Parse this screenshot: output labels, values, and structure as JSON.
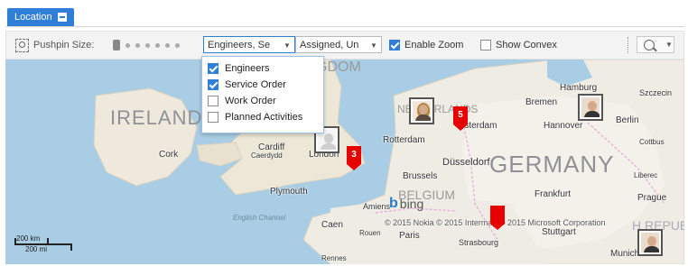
{
  "tab": {
    "label": "Location"
  },
  "toolbar": {
    "pushpin_label": "Pushpin Size:",
    "layer_dropdown": "Engineers, Se",
    "status_dropdown": "Assigned, Un",
    "enable_zoom_label": "Enable Zoom",
    "enable_zoom_checked": true,
    "show_convex_label": "Show Convex",
    "show_convex_checked": false
  },
  "layer_menu": {
    "items": [
      {
        "label": "Engineers",
        "checked": true
      },
      {
        "label": "Service Order",
        "checked": true
      },
      {
        "label": "Work Order",
        "checked": false
      },
      {
        "label": "Planned Activities",
        "checked": false
      }
    ]
  },
  "map": {
    "places": {
      "ireland": "IRELAND",
      "kingdom": "GDOM",
      "germany": "GERMANY",
      "belgium": "BELGIUM",
      "czech": "H REPUBL",
      "cork": "Cork",
      "cardiff": "Cardiff",
      "cardiff_local": "Caerdydd",
      "london": "London",
      "plymouth": "Plymouth",
      "english_channel": "English Channel",
      "rotterdam": "Rotterdam",
      "amsterdam": "msterdam",
      "netherlands": "NETHERLANDS",
      "hamburg": "Hamburg",
      "bremen": "Bremen",
      "szczecin": "Szczecin",
      "hannover": "Hannover",
      "berlin": "Berlin",
      "cottbus": "Cottbus",
      "dusseldorf": "Düsseldorf",
      "brussels": "Brussels",
      "frankfurt": "Frankfurt",
      "liberec": "Liberec",
      "prague": "Prague",
      "amiens": "Amiens",
      "caen": "Caen",
      "rouen": "Rouen",
      "paris": "Paris",
      "stuttgart": "Stuttgart",
      "strasbourg": "Strasbourg",
      "munich": "Munich",
      "rennes": "Rennes"
    },
    "brand": "bing",
    "copyright": "© 2015 Nokia © 2015 Intermap © 2015 Microsoft Corporation",
    "scale_top": "200 km",
    "scale_bottom": "200 mi",
    "pins": [
      {
        "number": "3"
      },
      {
        "number": "5"
      },
      {
        "number": ""
      }
    ]
  },
  "colors": {
    "accent": "#2f7fd8",
    "pin": "#e60000",
    "water": "#a9cde4",
    "land": "#f2efe9"
  }
}
